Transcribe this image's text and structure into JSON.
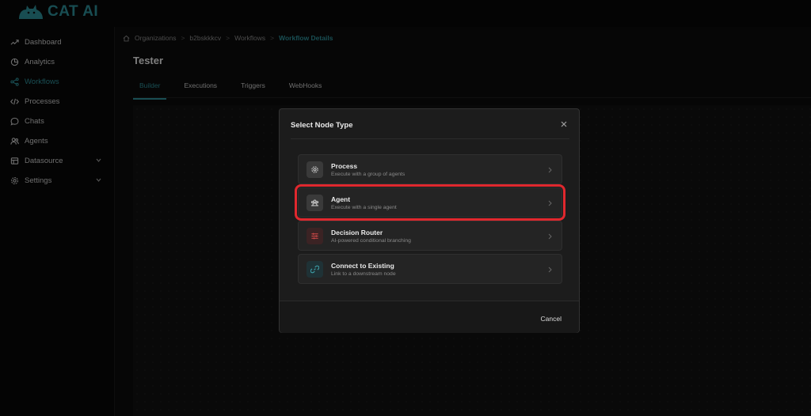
{
  "app": {
    "logo_text": "CAT AI"
  },
  "sidebar": {
    "items": [
      {
        "label": "Dashboard",
        "icon": "trend-icon"
      },
      {
        "label": "Analytics",
        "icon": "pie-icon"
      },
      {
        "label": "Workflows",
        "icon": "share-icon",
        "active": true
      },
      {
        "label": "Processes",
        "icon": "code-icon"
      },
      {
        "label": "Chats",
        "icon": "chat-icon"
      },
      {
        "label": "Agents",
        "icon": "users-icon"
      },
      {
        "label": "Datasource",
        "icon": "database-icon",
        "has_chevron": true
      },
      {
        "label": "Settings",
        "icon": "gear-icon",
        "has_chevron": true
      }
    ]
  },
  "breadcrumb": {
    "items": [
      "Organizations",
      "b2bskkkcv",
      "Workflows",
      "Workflow Details"
    ]
  },
  "page": {
    "title": "Tester",
    "tabs": [
      "Builder",
      "Executions",
      "Triggers",
      "WebHooks"
    ],
    "active_tab": "Builder"
  },
  "modal": {
    "title": "Select Node Type",
    "cancel_label": "Cancel",
    "options": [
      {
        "title": "Process",
        "description": "Execute with a group of agents",
        "icon": "gear-icon",
        "icon_bg": "#3a3a3a",
        "icon_color": "#cfcfcf"
      },
      {
        "title": "Agent",
        "description": "Execute with a single agent",
        "icon": "agents-icon",
        "icon_bg": "#3a3a3a",
        "icon_color": "#cfcfcf",
        "highlighted": true
      },
      {
        "title": "Decision Router",
        "description": "AI-powered conditional branching",
        "icon": "sliders-icon",
        "icon_bg": "#3b2324",
        "icon_color": "#d44a4a"
      },
      {
        "title": "Connect to Existing",
        "description": "Link to a downstream node",
        "icon": "link-icon",
        "icon_bg": "#1f3236",
        "icon_color": "#3fa4ad"
      }
    ]
  },
  "colors": {
    "accent": "#2e8f98",
    "highlight": "#e0282e"
  }
}
